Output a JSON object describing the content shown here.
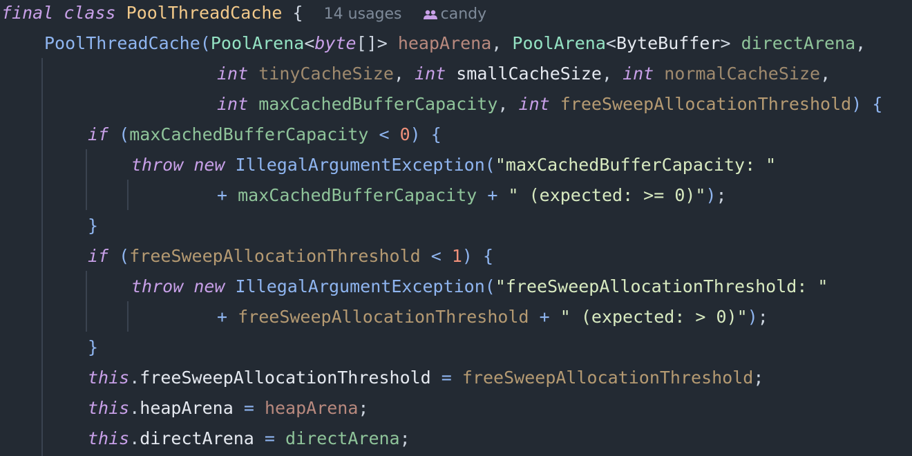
{
  "editor": {
    "class_header": {
      "kw_final": "final",
      "kw_class": "class",
      "class_name": "PoolThreadCache",
      "brace": "{",
      "usages": "14 usages",
      "author": "candy"
    },
    "ctor_line1": {
      "name": "PoolThreadCache",
      "open": "(",
      "t1": "PoolArena",
      "lt": "<",
      "t1_arg": "byte",
      "arr": "[]",
      "gt": ">",
      "p1": "heapArena",
      "comma": ",",
      "t2": "PoolArena",
      "t2_arg": "ByteBuffer",
      "p2": "directArena"
    },
    "ctor_line2": {
      "int": "int",
      "p3": "tinyCacheSize",
      "p4": "smallCacheSize",
      "p5": "normalCacheSize",
      "comma": ","
    },
    "ctor_line3": {
      "int": "int",
      "p6": "maxCachedBufferCapacity",
      "p7": "freeSweepAllocationThreshold",
      "close": ")",
      "brace": "{"
    },
    "if1": {
      "kw": "if",
      "open": "(",
      "var": "maxCachedBufferCapacity",
      "op": "<",
      "num": "0",
      "close": ")",
      "brace": "{"
    },
    "throw1": {
      "kw_throw": "throw",
      "kw_new": "new",
      "exc": "IllegalArgumentException",
      "open": "(",
      "str": "\"maxCachedBufferCapacity: \""
    },
    "throw1_cont": {
      "plus": "+",
      "var": "maxCachedBufferCapacity",
      "plus2": "+",
      "str": "\" (expected: >= 0)\"",
      "close": ")",
      "semi": ";"
    },
    "close1": "}",
    "if2": {
      "kw": "if",
      "open": "(",
      "var": "freeSweepAllocationThreshold",
      "op": "<",
      "num": "1",
      "close": ")",
      "brace": "{"
    },
    "throw2": {
      "kw_throw": "throw",
      "kw_new": "new",
      "exc": "IllegalArgumentException",
      "open": "(",
      "str": "\"freeSweepAllocationThreshold: \""
    },
    "throw2_cont": {
      "plus": "+",
      "var": "freeSweepAllocationThreshold",
      "plus2": "+",
      "str": "\" (expected: > 0)\"",
      "close": ")",
      "semi": ";"
    },
    "close2": "}",
    "assign1": {
      "this": "this",
      "dot": ".",
      "field": "freeSweepAllocationThreshold",
      "eq": "=",
      "value": "freeSweepAllocationThreshold",
      "semi": ";"
    },
    "assign2": {
      "this": "this",
      "dot": ".",
      "field": "heapArena",
      "eq": "=",
      "value": "heapArena",
      "semi": ";"
    },
    "assign3": {
      "this": "this",
      "dot": ".",
      "field": "directArena",
      "eq": "=",
      "value": "directArena",
      "semi": ";"
    }
  }
}
